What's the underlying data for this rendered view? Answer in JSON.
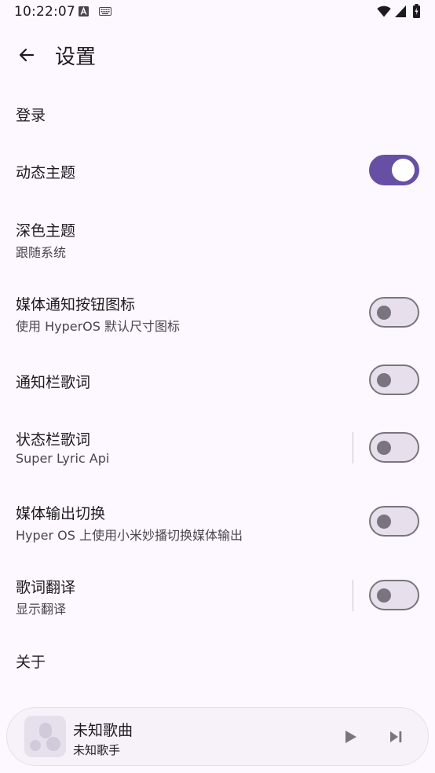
{
  "status_bar": {
    "time": "10:22:07"
  },
  "appbar": {
    "title": "设置",
    "back_icon": "arrow-left-icon"
  },
  "settings": {
    "login": {
      "title": "登录"
    },
    "dynamic_theme": {
      "title": "动态主题",
      "enabled": true
    },
    "dark_theme": {
      "title": "深色主题",
      "subtitle": "跟随系统"
    },
    "media_notif_icon": {
      "title": "媒体通知按钮图标",
      "subtitle": "使用 HyperOS 默认尺寸图标",
      "enabled": false
    },
    "notif_lyrics": {
      "title": "通知栏歌词",
      "enabled": false
    },
    "statusbar_lyrics": {
      "title": "状态栏歌词",
      "subtitle": "Super Lyric Api",
      "enabled": false
    },
    "media_output": {
      "title": "媒体输出切换",
      "subtitle": "Hyper OS 上使用小米妙播切换媒体输出",
      "enabled": false
    },
    "lyrics_translation": {
      "title": "歌词翻译",
      "subtitle": "显示翻译",
      "enabled": false
    },
    "about": {
      "title": "关于"
    }
  },
  "player": {
    "title": "未知歌曲",
    "artist": "未知歌手",
    "play_icon": "play-icon",
    "next_icon": "skip-next-icon"
  },
  "colors": {
    "background": "#fdf7ff",
    "accent": "#6750a4",
    "switch_off_track": "#e7e0ec",
    "switch_off_outline": "#79747e"
  }
}
